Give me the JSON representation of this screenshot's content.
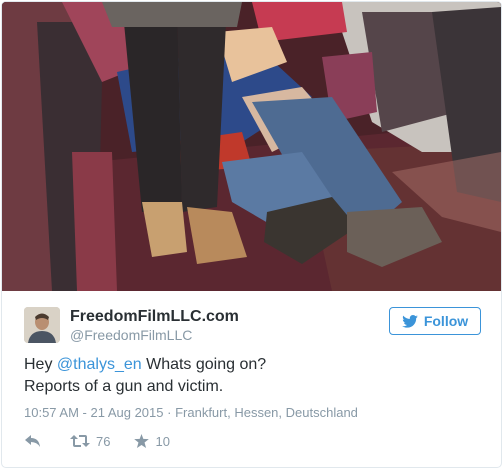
{
  "tweet": {
    "display_name": "FreedomFilmLLC.com",
    "handle": "@FreedomFilmLLC",
    "follow_label": "Follow",
    "text_intro": "Hey ",
    "mention": "@thalys_en",
    "text_line1_rest": " Whats going on?",
    "text_line2": "Reports of a gun and victim.",
    "timestamp": "10:57 AM - 21 Aug 2015",
    "separator": "·",
    "location": "Frankfurt, Hessen, Deutschland",
    "retweet_count": "76",
    "like_count": "10"
  },
  "icons": {
    "follow": "twitter-bird-icon",
    "reply": "reply-icon",
    "retweet": "retweet-icon",
    "like": "star-icon"
  },
  "colors": {
    "link_blue": "#3b94d9",
    "text": "#292f33",
    "muted": "#8899a6",
    "border": "#e1e8ed"
  }
}
